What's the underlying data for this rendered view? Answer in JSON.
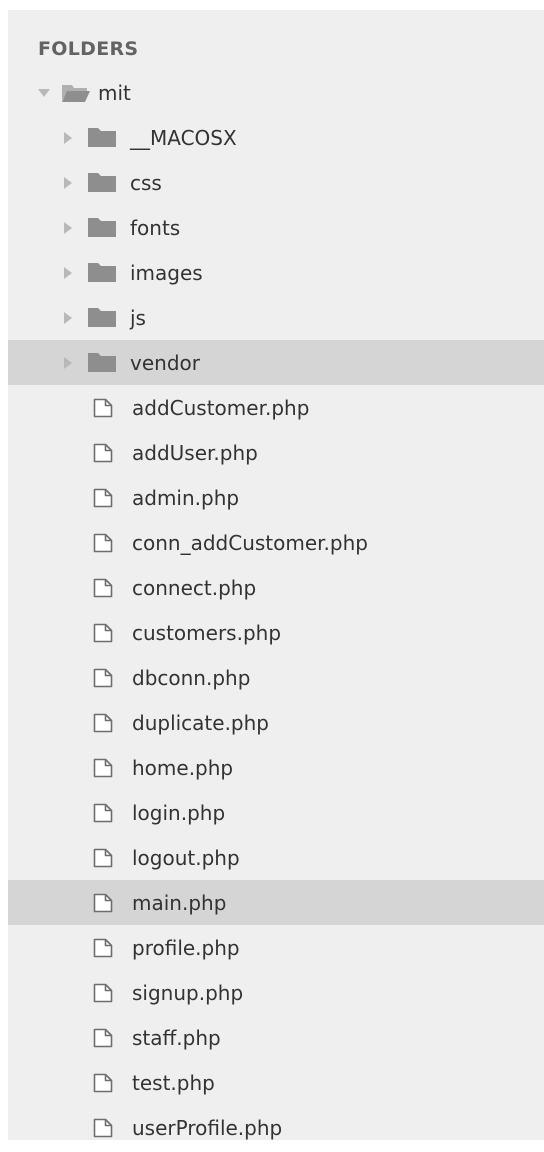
{
  "sidebar": {
    "header": "FOLDERS",
    "root": {
      "label": "mit",
      "icon": "folder-open-icon",
      "expanded": true
    },
    "folders": [
      {
        "label": "__MACOSX",
        "icon": "folder-icon",
        "selected": false
      },
      {
        "label": "css",
        "icon": "folder-icon",
        "selected": false
      },
      {
        "label": "fonts",
        "icon": "folder-icon",
        "selected": false
      },
      {
        "label": "images",
        "icon": "folder-icon",
        "selected": false
      },
      {
        "label": "js",
        "icon": "folder-icon",
        "selected": false
      },
      {
        "label": "vendor",
        "icon": "folder-icon",
        "selected": true
      }
    ],
    "files": [
      {
        "label": "addCustomer.php",
        "icon": "file-icon",
        "selected": false
      },
      {
        "label": "addUser.php",
        "icon": "file-icon",
        "selected": false
      },
      {
        "label": "admin.php",
        "icon": "file-icon",
        "selected": false
      },
      {
        "label": "conn_addCustomer.php",
        "icon": "file-icon",
        "selected": false
      },
      {
        "label": "connect.php",
        "icon": "file-icon",
        "selected": false
      },
      {
        "label": "customers.php",
        "icon": "file-icon",
        "selected": false
      },
      {
        "label": "dbconn.php",
        "icon": "file-icon",
        "selected": false
      },
      {
        "label": "duplicate.php",
        "icon": "file-icon",
        "selected": false
      },
      {
        "label": "home.php",
        "icon": "file-icon",
        "selected": false
      },
      {
        "label": "login.php",
        "icon": "file-icon",
        "selected": false
      },
      {
        "label": "logout.php",
        "icon": "file-icon",
        "selected": false
      },
      {
        "label": "main.php",
        "icon": "file-icon",
        "selected": true
      },
      {
        "label": "profile.php",
        "icon": "file-icon",
        "selected": false
      },
      {
        "label": "signup.php",
        "icon": "file-icon",
        "selected": false
      },
      {
        "label": "staff.php",
        "icon": "file-icon",
        "selected": false
      },
      {
        "label": "test.php",
        "icon": "file-icon",
        "selected": false
      },
      {
        "label": "userProfile.php",
        "icon": "file-icon",
        "selected": false
      }
    ],
    "colors": {
      "background": "#efefef",
      "selected": "#d5d5d6",
      "folder": "#8e8e8e",
      "text": "#333333",
      "header": "#636363"
    }
  }
}
